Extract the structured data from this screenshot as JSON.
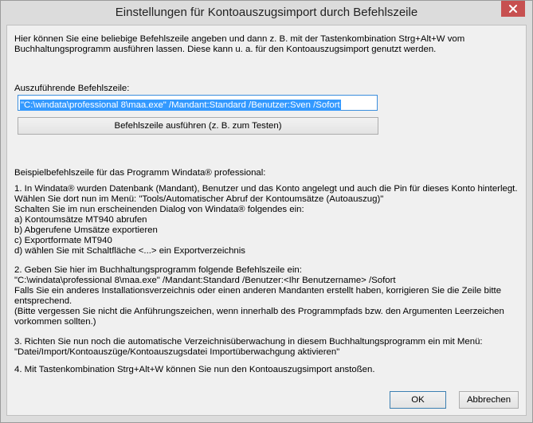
{
  "window": {
    "title": "Einstellungen für Kontoauszugsimport durch Befehlszeile",
    "close_icon": "close-icon",
    "close_color": "#c75050"
  },
  "intro": {
    "line1": "Hier können Sie eine beliebige Befehlszeile angeben und dann z. B. mit der Tastenkombination Strg+Alt+W vom",
    "line2": "Buchhaltungsprogramm ausführen lassen. Diese kann u. a. für den Kontoauszugsimport genutzt werden."
  },
  "command": {
    "label": "Auszuführende Befehlszeile:",
    "value": "\"C:\\windata\\professional 8\\maa.exe\" /Mandant:Standard /Benutzer:Sven /Sofort",
    "run_button": "Befehlszeile ausführen (z. B. zum Testen)",
    "selection_color": "#3399ff"
  },
  "example": {
    "heading": "Beispielbefehlszeile für das Programm Windata® professional:",
    "step1": [
      "1. In Windata® wurden Datenbank (Mandant), Benutzer und das Konto angelegt und auch die Pin für dieses Konto hinterlegt.",
      "Wählen Sie dort nun im Menü: \"Tools/Automatischer Abruf der Kontoumsätze (Autoauszug)\"",
      "Schalten Sie im nun erscheinenden Dialog von Windata® folgendes ein:",
      "a) Kontoumsätze MT940 abrufen",
      "b) Abgerufene Umsätze exportieren",
      "c) Exportformate MT940",
      "d) wählen Sie mit Schaltfläche <...> ein Exportverzeichnis"
    ],
    "step2": [
      "2. Geben Sie hier im Buchhaltungsprogramm folgende Befehlszeile ein:",
      "\"C:\\windata\\professional 8\\maa.exe\" /Mandant:Standard /Benutzer:<Ihr Benutzername> /Sofort",
      "Falls Sie ein anderes Installationsverzeichnis oder einen anderen Mandanten erstellt haben, korrigieren Sie die Zeile bitte",
      "entsprechend.",
      "(Bitte vergessen Sie nicht die Anführungszeichen, wenn innerhalb des Programmpfads bzw. den Argumenten Leerzeichen",
      "vorkommen sollten.)"
    ],
    "step3": [
      "3. Richten Sie nun noch die automatische Verzeichnisüberwachung in diesem Buchhaltungsprogramm ein mit Menü:",
      "\"Datei/Import/Kontoauszüge/Kontoauszugsdatei Importüberwachgung aktivieren\""
    ],
    "step4": "4. Mit Tastenkombination Strg+Alt+W können Sie nun den Kontoauszugsimport anstoßen."
  },
  "buttons": {
    "ok": "OK",
    "cancel": "Abbrechen"
  }
}
